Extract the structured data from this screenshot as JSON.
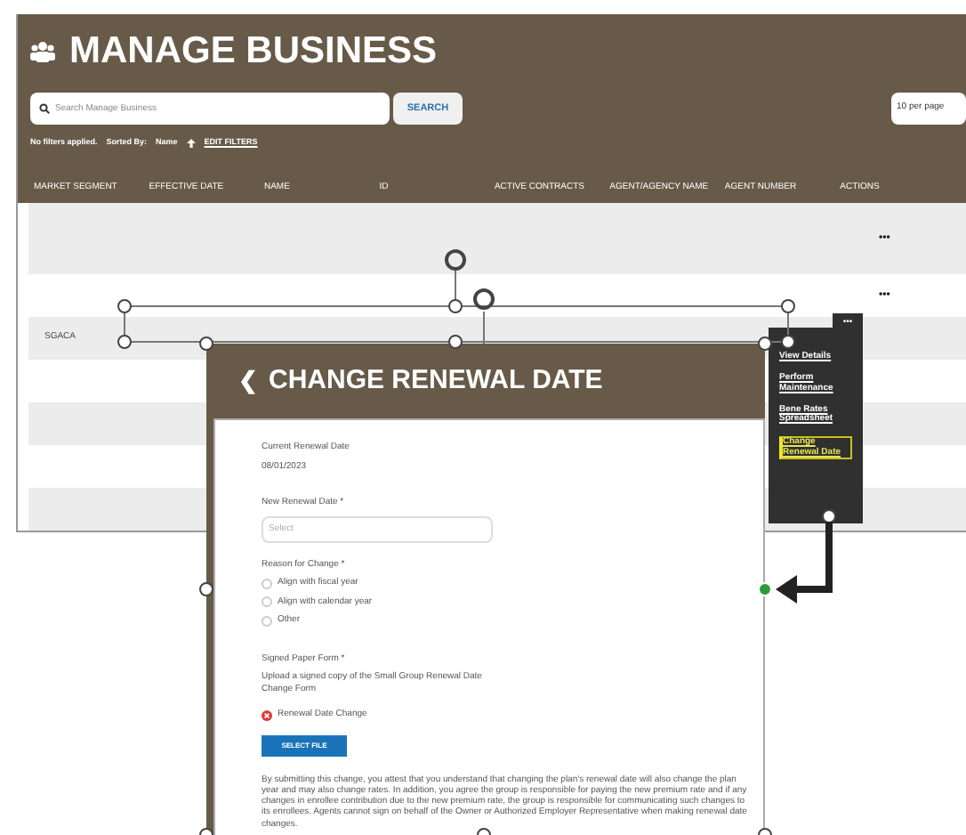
{
  "page": {
    "title": "MANAGE BUSINESS"
  },
  "search": {
    "placeholder": "Search Manage Business",
    "button": "SEARCH",
    "per_page": "10 per page"
  },
  "filters": {
    "status": "No filters applied.",
    "sorted_by_label": "Sorted By:",
    "sorted_by": "Name",
    "edit": "EDIT FILTERS"
  },
  "table": {
    "columns": [
      "MARKET SEGMENT",
      "EFFECTIVE DATE",
      "NAME",
      "ID",
      "ACTIVE CONTRACTS",
      "AGENT/AGENCY NAME",
      "AGENT NUMBER",
      "ACTIONS"
    ],
    "rows": [
      {
        "market_segment": "",
        "actions": "•••",
        "menu_open": false
      },
      {
        "market_segment": "",
        "actions": "•••",
        "menu_open": false
      },
      {
        "market_segment": "SGACA",
        "actions": "•••",
        "menu_open": true
      },
      {
        "market_segment": "",
        "actions": "",
        "menu_open": false
      },
      {
        "market_segment": "",
        "actions": "",
        "menu_open": false
      },
      {
        "market_segment": "",
        "actions": "",
        "menu_open": false
      },
      {
        "market_segment": "",
        "actions": "",
        "menu_open": false
      }
    ]
  },
  "actions_menu": {
    "items": [
      {
        "label": "View Details",
        "selected": false
      },
      {
        "label": "Perform Maintenance",
        "selected": false
      },
      {
        "label": "Bene Rates Spreadsheet",
        "selected": false
      },
      {
        "label": "Change Renewal Date",
        "selected": true
      }
    ]
  },
  "modal": {
    "title": "CHANGE RENEWAL DATE",
    "back": "❮",
    "current_label": "Current Renewal Date",
    "current_value": "08/01/2023",
    "new_label": "New Renewal Date *",
    "new_placeholder": "Select",
    "reason_label": "Reason for Change *",
    "reasons": [
      {
        "label": "Align with fiscal year",
        "selected": false
      },
      {
        "label": "Align with calendar year",
        "selected": false
      },
      {
        "label": "Other",
        "selected": false
      }
    ],
    "form_label": "Signed Paper Form *",
    "form_help": "Upload a signed copy of the Small Group Renewal Date Change Form",
    "file_status": "Renewal Date Change",
    "file_button": "SELECT FILE",
    "disclaimer": "By submitting this change, you attest that you understand that changing the plan's renewal date will also change the plan year and may also change rates. In addition, you agree the group is responsible for paying the new premium rate and if any changes in enrollee contribution due to the new premium rate, the group is responsible for communicating such changes to its enrollees. Agents cannot sign on behalf of the Owner or Authorized Employer Representative when making renewal date changes."
  }
}
